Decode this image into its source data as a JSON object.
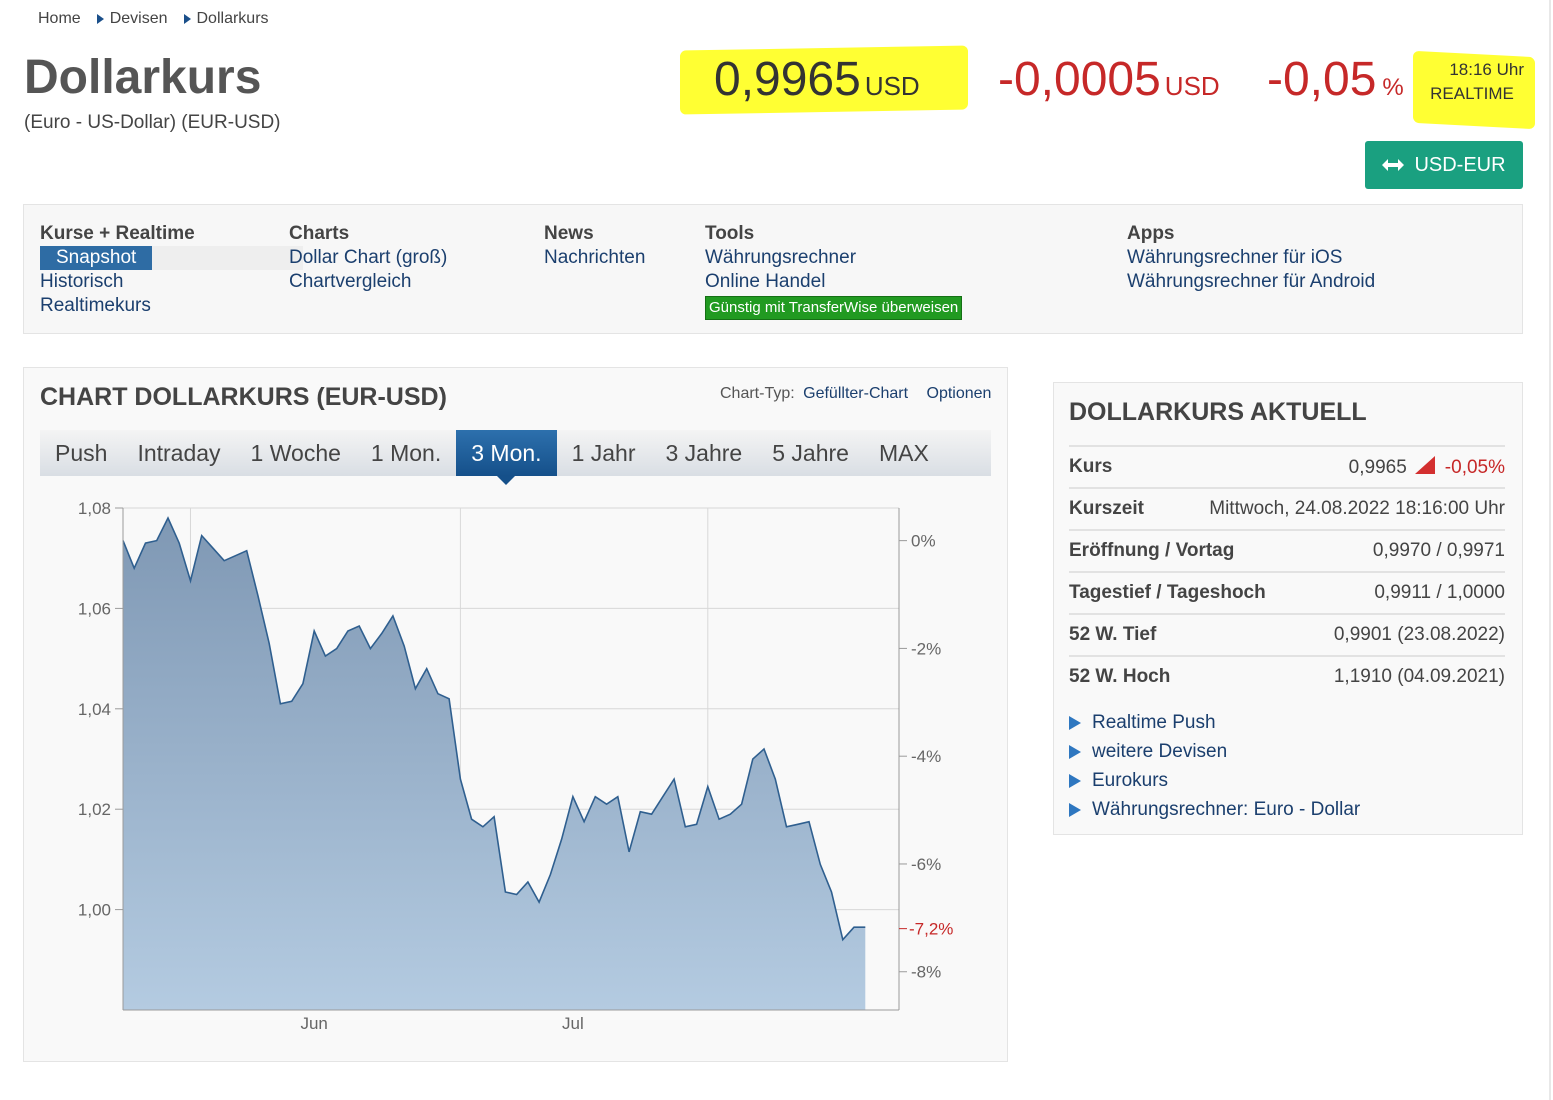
{
  "breadcrumb": [
    "Home",
    "Devisen",
    "Dollarkurs"
  ],
  "header": {
    "title": "Dollarkurs",
    "subtitle": "(Euro - US-Dollar) (EUR-USD)",
    "price": "0,9965",
    "price_unit": "USD",
    "change": "-0,0005",
    "change_unit": "USD",
    "change_pct": "-0,05",
    "pct_unit": "%",
    "time": "18:16 Uhr",
    "realtime": "REALTIME",
    "swap_button": "USD-EUR"
  },
  "colors": {
    "accent": "#1aa080",
    "negative": "#c62828",
    "link": "#1b3f6e",
    "highlight": "#ffff33"
  },
  "nav": {
    "kurse": {
      "head": "Kurse + Realtime",
      "items": [
        "Snapshot",
        "Historisch",
        "Realtimekurs"
      ]
    },
    "charts": {
      "head": "Charts",
      "items": [
        "Dollar Chart (groß)",
        "Chartvergleich"
      ]
    },
    "news": {
      "head": "News",
      "items": [
        "Nachrichten"
      ]
    },
    "tools": {
      "head": "Tools",
      "items": [
        "Währungsrechner",
        "Online Handel"
      ],
      "badge": "Günstig mit TransferWise überweisen"
    },
    "apps": {
      "head": "Apps",
      "items": [
        "Währungsrechner für iOS",
        "Währungsrechner für Android"
      ]
    }
  },
  "chart_panel": {
    "title": "CHART DOLLARKURS (EUR-USD)",
    "type_label": "Chart-Typ:",
    "type_value": "Gefüllter-Chart",
    "options": "Optionen",
    "tabs": [
      "Push",
      "Intraday",
      "1 Woche",
      "1 Mon.",
      "3 Mon.",
      "1 Jahr",
      "3 Jahre",
      "5 Jahre",
      "MAX"
    ],
    "active_tab": "3 Mon."
  },
  "chart_data": {
    "type": "area",
    "ylim": [
      0.98,
      1.08
    ],
    "yticks": [
      "1,08",
      "1,06",
      "1,04",
      "1,02",
      "1,00"
    ],
    "yticks_values": [
      1.08,
      1.06,
      1.04,
      1.02,
      1.0
    ],
    "right_ticks": [
      "0%",
      "-2%",
      "-4%",
      "-6%",
      "-8%"
    ],
    "right_ticks_values": [
      0,
      -2,
      -4,
      -6,
      -8
    ],
    "right_marker": "-7,2%",
    "right_marker_value": -7.2,
    "xlabels": [
      "Jun",
      "Jul"
    ],
    "x_count": 70,
    "x_label_index": [
      17,
      40
    ],
    "x_grid_index": [
      6,
      30,
      52
    ],
    "values": [
      1.0735,
      1.068,
      1.073,
      1.0735,
      1.078,
      1.073,
      1.0655,
      1.0745,
      1.072,
      1.0695,
      1.0705,
      1.0715,
      1.0625,
      1.053,
      1.041,
      1.0415,
      1.045,
      1.0555,
      1.0505,
      1.052,
      1.0555,
      1.0565,
      1.052,
      1.055,
      1.0585,
      1.0525,
      1.044,
      1.048,
      1.043,
      1.042,
      1.026,
      1.018,
      1.0165,
      1.0185,
      1.0035,
      1.003,
      1.0055,
      1.0015,
      1.007,
      1.014,
      1.0225,
      1.0175,
      1.0225,
      1.021,
      1.0225,
      1.0115,
      1.0195,
      1.019,
      1.0225,
      1.026,
      1.0165,
      1.017,
      1.0245,
      1.018,
      1.019,
      1.021,
      1.03,
      1.032,
      1.026,
      1.0165,
      1.017,
      1.0175,
      1.009,
      1.0035,
      0.994,
      0.9965,
      0.9965
    ]
  },
  "side": {
    "title": "DOLLARKURS AKTUELL",
    "rows": [
      {
        "k": "Kurs",
        "v": "0,9965",
        "extra": "-0,05%"
      },
      {
        "k": "Kurszeit",
        "v": "Mittwoch, 24.08.2022 18:16:00 Uhr"
      },
      {
        "k": "Eröffnung / Vortag",
        "v": "0,9970 / 0,9971"
      },
      {
        "k": "Tagestief / Tageshoch",
        "v": "0,9911 / 1,0000"
      },
      {
        "k": "52 W. Tief",
        "v": "0,9901 (23.08.2022)"
      },
      {
        "k": "52 W. Hoch",
        "v": "1,1910 (04.09.2021)"
      }
    ],
    "links": [
      "Realtime Push",
      "weitere Devisen",
      "Eurokurs",
      "Währungsrechner: Euro - Dollar"
    ]
  }
}
